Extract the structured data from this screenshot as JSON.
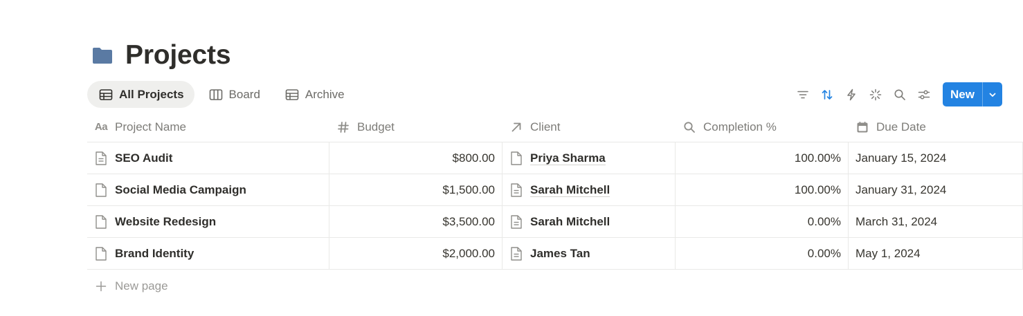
{
  "page": {
    "title": "Projects",
    "icon": "folder-icon"
  },
  "views": [
    {
      "label": "All Projects",
      "icon": "table-icon",
      "active": true
    },
    {
      "label": "Board",
      "icon": "board-icon",
      "active": false
    },
    {
      "label": "Archive",
      "icon": "table-icon",
      "active": false
    }
  ],
  "toolbar": {
    "icons": [
      "filter-icon",
      "sort-icon",
      "automation-icon",
      "ai-sparkle-icon",
      "search-icon",
      "settings-icon"
    ],
    "new_label": "New",
    "accent": "#2383e2"
  },
  "table": {
    "columns": [
      {
        "label": "Project Name",
        "icon": "title-icon"
      },
      {
        "label": "Budget",
        "icon": "number-icon"
      },
      {
        "label": "Client",
        "icon": "relation-icon"
      },
      {
        "label": "Completion %",
        "icon": "rollup-icon"
      },
      {
        "label": "Due Date",
        "icon": "calendar-icon"
      }
    ],
    "rows": [
      {
        "name": "SEO Audit",
        "budget": "$800.00",
        "client": "Priya Sharma",
        "completion": "100.00%",
        "due": "January 15, 2024"
      },
      {
        "name": "Social Media Campaign",
        "budget": "$1,500.00",
        "client": "Sarah Mitchell",
        "completion": "100.00%",
        "due": "January 31, 2024"
      },
      {
        "name": "Website Redesign",
        "budget": "$3,500.00",
        "client": "Sarah Mitchell",
        "completion": "0.00%",
        "due": "March 31, 2024"
      },
      {
        "name": "Brand Identity",
        "budget": "$2,000.00",
        "client": "James Tan",
        "completion": "0.00%",
        "due": "May 1, 2024"
      }
    ],
    "new_page_label": "New page"
  }
}
